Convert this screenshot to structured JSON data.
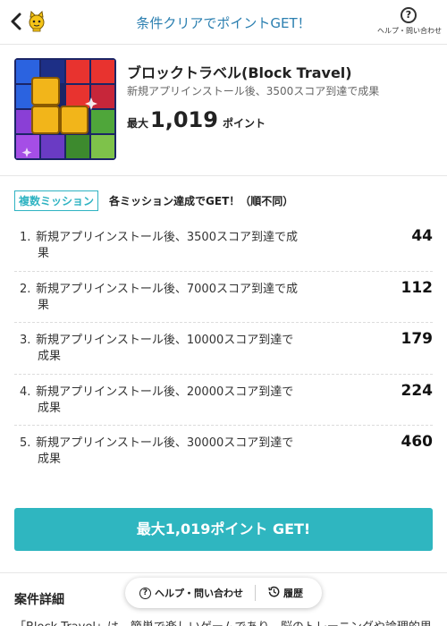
{
  "header": {
    "title": "条件クリアでポイントGET！",
    "help_label": "ヘルプ・問い合わせ",
    "help_icon": "?"
  },
  "app": {
    "name": "ブロックトラベル(Block Travel)",
    "description": "新規アプリインストール後、3500スコア到達で成果",
    "max_prefix": "最大",
    "max_points": "1,019",
    "max_unit": "ポイント"
  },
  "missions": {
    "badge": "複数ミッション",
    "note": "各ミッション達成でGET！（順不同）",
    "items": [
      {
        "index": "1.",
        "line1": "新規アプリインストール後、3500スコア到達で成",
        "line2": "果",
        "points": "44"
      },
      {
        "index": "2.",
        "line1": "新規アプリインストール後、7000スコア到達で成",
        "line2": "果",
        "points": "112"
      },
      {
        "index": "3.",
        "line1": "新規アプリインストール後、10000スコア到達で",
        "line2": "成果",
        "points": "179"
      },
      {
        "index": "4.",
        "line1": "新規アプリインストール後、20000スコア到達で",
        "line2": "成果",
        "points": "224"
      },
      {
        "index": "5.",
        "line1": "新規アプリインストール後、30000スコア到達で",
        "line2": "成果",
        "points": "460"
      }
    ]
  },
  "cta": {
    "label": "最大1,019ポイント GET!"
  },
  "details": {
    "title": "案件詳細",
    "body": "「Block Travel」は、簡単で楽しいゲームであり、脳のトレーニングや論理的思"
  },
  "floatbar": {
    "help": "ヘルプ・問い合わせ",
    "history": "履歴"
  },
  "colors": {
    "accent": "#2fb6c0",
    "header_title": "#2b7fb0"
  }
}
